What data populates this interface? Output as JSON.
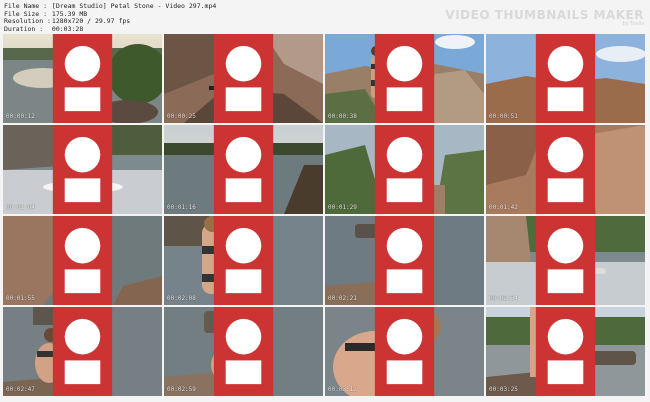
{
  "info": {
    "file_name_label": "File Name :",
    "file_name": "[Dream Studio] Petal Stone - Video 297.mp4",
    "file_size_label": "File Size :",
    "file_size": "175.39 MB",
    "resolution_label": "Resolution :",
    "resolution": "1280x720 / 29.97 fps",
    "duration_label": "Duration :",
    "duration": "00:03:28"
  },
  "brand": {
    "title": "VIDEO THUMBNAILS MAKER",
    "subtitle": "by Toolis"
  },
  "thumbnails": [
    {
      "time": "00:00:12"
    },
    {
      "time": "00:00:25"
    },
    {
      "time": "00:00:38"
    },
    {
      "time": "00:00:51"
    },
    {
      "time": "00:01:04"
    },
    {
      "time": "00:01:16"
    },
    {
      "time": "00:01:29"
    },
    {
      "time": "00:01:42"
    },
    {
      "time": "00:01:55"
    },
    {
      "time": "00:02:08"
    },
    {
      "time": "00:02:21"
    },
    {
      "time": "00:02:34"
    },
    {
      "time": "00:02:47"
    },
    {
      "time": "00:02:59"
    },
    {
      "time": "00:03:12"
    },
    {
      "time": "00:03:25"
    }
  ]
}
